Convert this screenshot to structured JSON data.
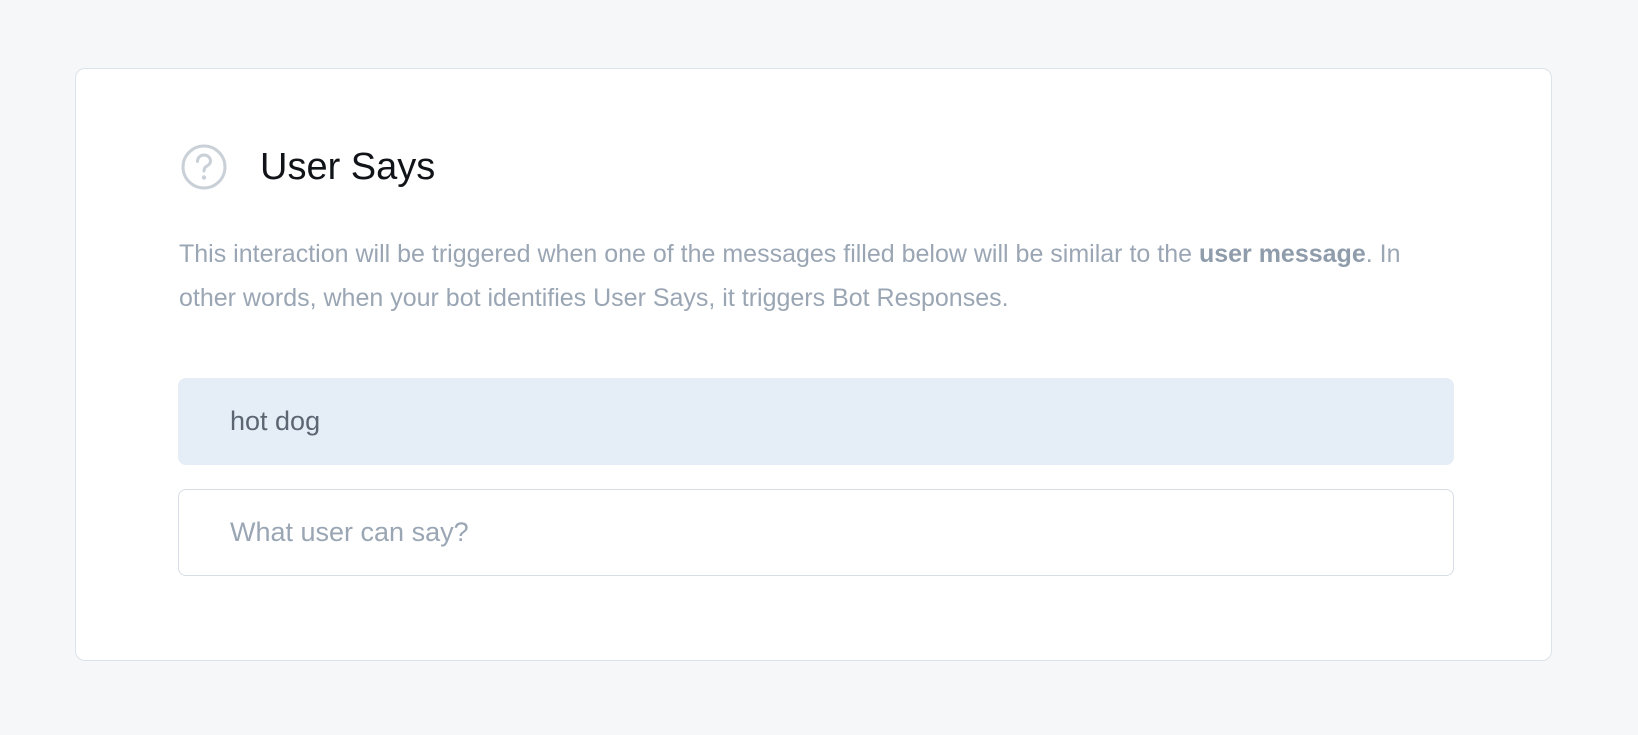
{
  "section": {
    "icon": "question-circle-icon",
    "title": "User Says",
    "description_before": "This interaction will be triggered when one of the messages filled below will be similar to the ",
    "description_bold": "user message",
    "description_after": ". In other words, when your bot identifies User Says, it triggers Bot Responses."
  },
  "phrases": [
    {
      "text": "hot dog"
    }
  ],
  "new_phrase_input": {
    "placeholder": "What user can say?",
    "value": ""
  },
  "colors": {
    "page_background": "#f5f7f9",
    "card_background": "#ffffff",
    "phrase_background": "#e5edf6",
    "muted_text": "#9aa6b4"
  }
}
